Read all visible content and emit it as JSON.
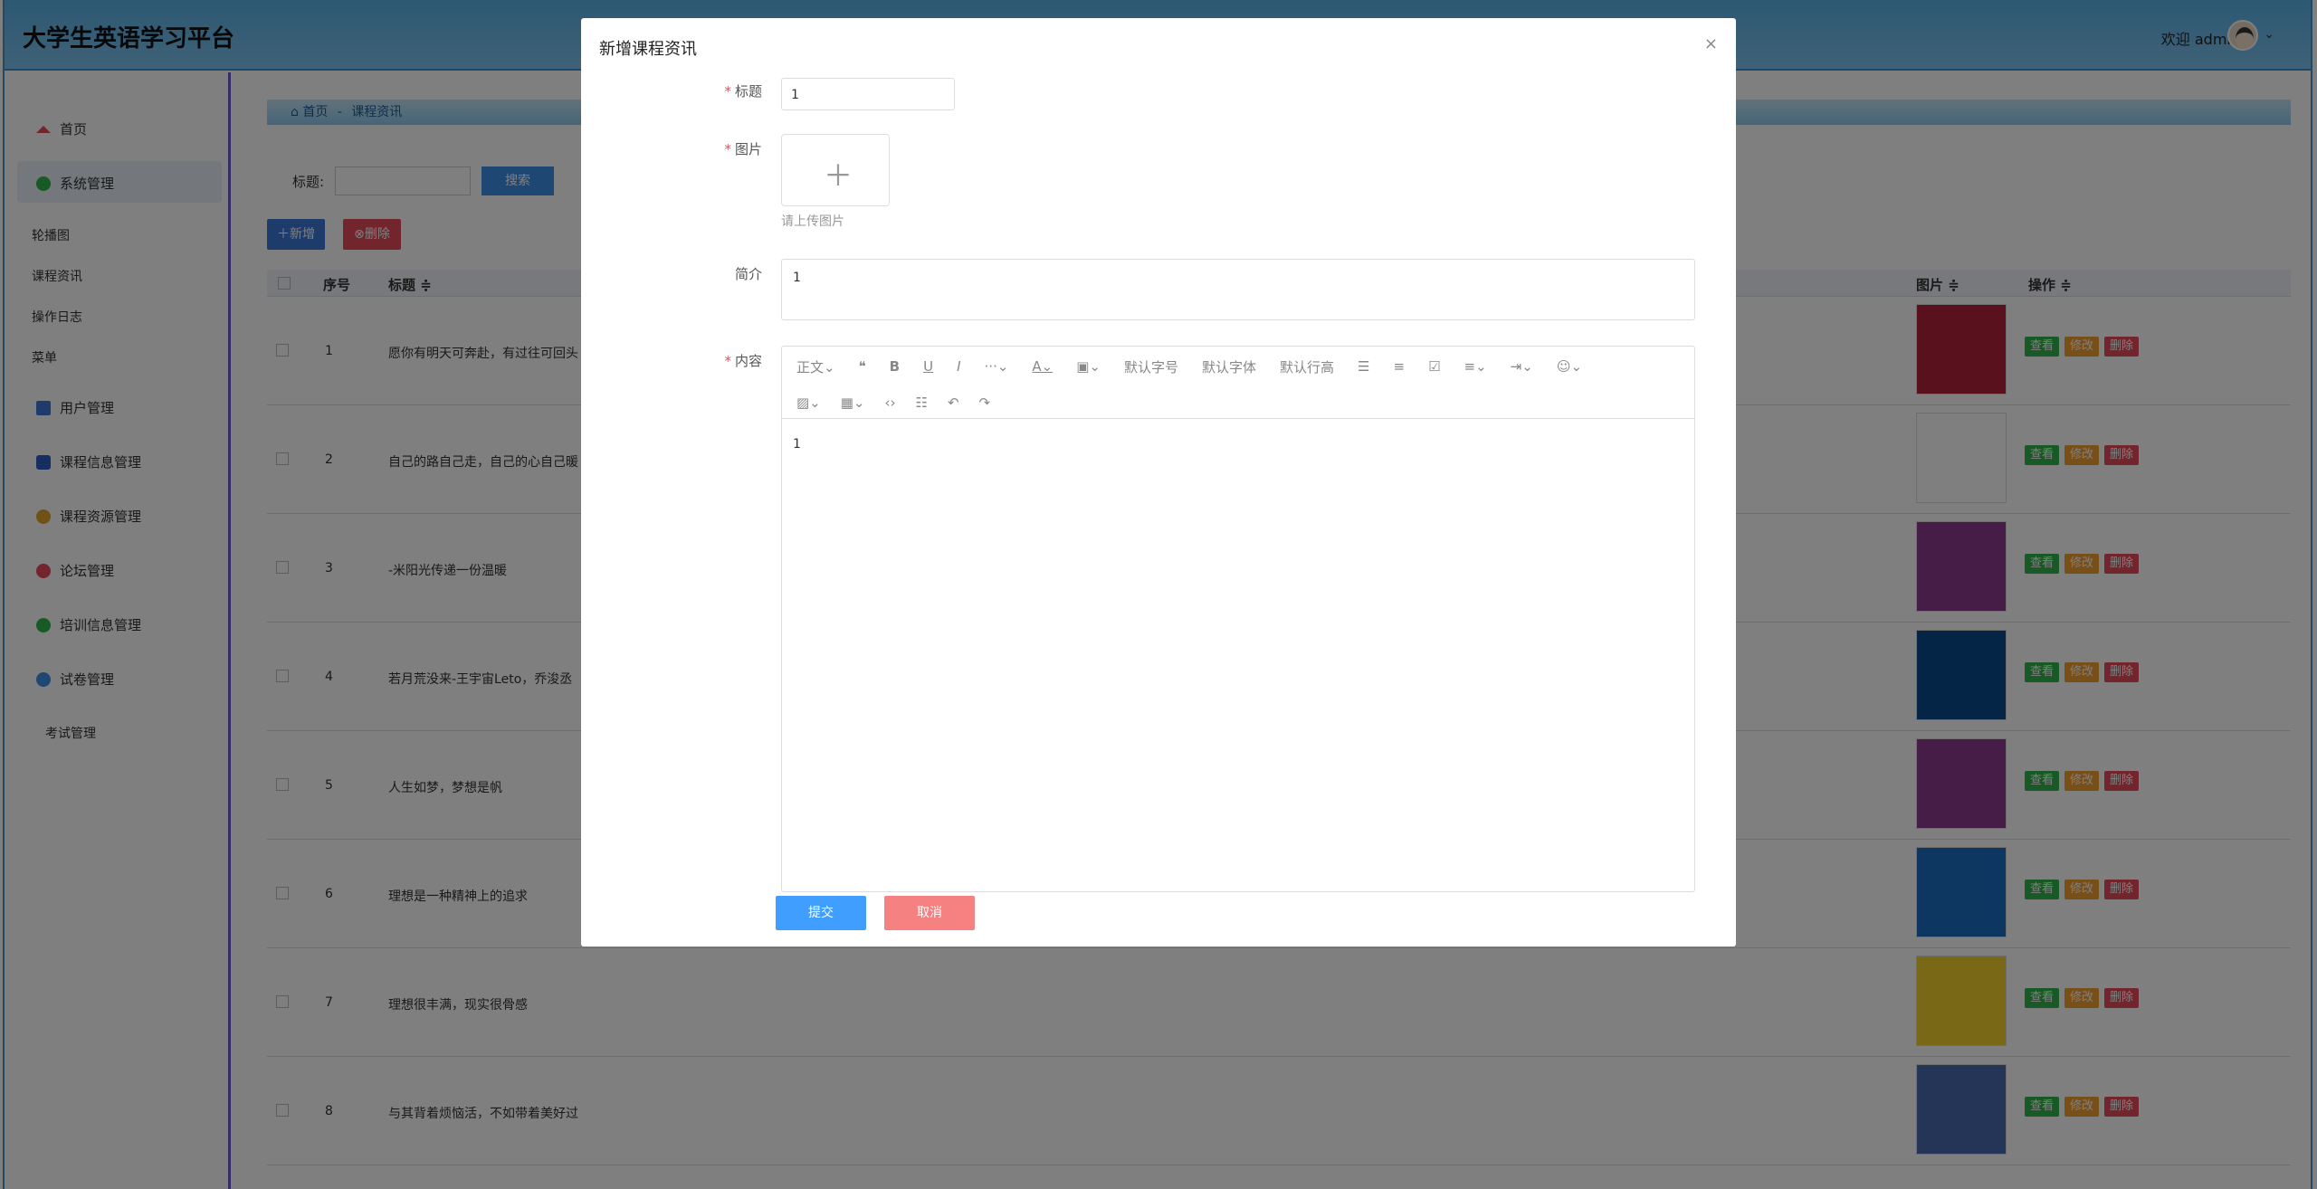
{
  "header": {
    "app_title": "大学生英语学习平台",
    "welcome": "欢迎 admin"
  },
  "sidebar": {
    "home": "首页",
    "system": "系统管理",
    "sub": [
      "轮播图",
      "课程资讯",
      "操作日志",
      "菜单"
    ],
    "items": [
      "用户管理",
      "课程信息管理",
      "课程资源管理",
      "论坛管理",
      "培训信息管理",
      "试卷管理"
    ],
    "exam": "考试管理"
  },
  "content": {
    "breadcrumb_home": "首页",
    "breadcrumb_sep": "-",
    "breadcrumb_current": "课程资讯",
    "search_label": "标题:",
    "search_button": "搜索",
    "add_button": "新增",
    "delete_button": "删除",
    "table": {
      "columns": [
        "序号",
        "标题 ≑",
        "图片 ≑",
        "操作 ≑"
      ],
      "rows": [
        {
          "idx": "1",
          "title": "愿你有明天可奔赴，有过往可回头"
        },
        {
          "idx": "2",
          "title": "自己的路自己走，自己的心自己暖"
        },
        {
          "idx": "3",
          "title": "-米阳光传递一份温暖"
        },
        {
          "idx": "4",
          "title": "若月荒没来-王宇宙Leto，乔浚丞"
        },
        {
          "idx": "5",
          "title": "人生如梦，梦想是帆"
        },
        {
          "idx": "6",
          "title": "理想是一种精神上的追求"
        },
        {
          "idx": "7",
          "title": "理想很丰满，现实很骨感"
        },
        {
          "idx": "8",
          "title": "与其背着烦恼活，不如带着美好过"
        }
      ],
      "ops": {
        "view": "查看",
        "edit": "修改",
        "del": "删除"
      }
    }
  },
  "modal": {
    "title": "新增课程资讯",
    "close": "×",
    "label_title": "标题",
    "title_value": "1",
    "label_image": "图片",
    "upload_tip": "请上传图片",
    "label_intro": "简介",
    "intro_value": "1",
    "label_content": "内容",
    "content_value": "1",
    "toolbar": {
      "paragraph": "正文",
      "font_size": "默认字号",
      "font_family": "默认字体",
      "line_height": "默认行高"
    },
    "submit": "提交",
    "cancel": "取消"
  },
  "colors": {
    "primary": "#409eff",
    "danger": "#f56c6c",
    "header_bg": "#5ab0e6"
  }
}
